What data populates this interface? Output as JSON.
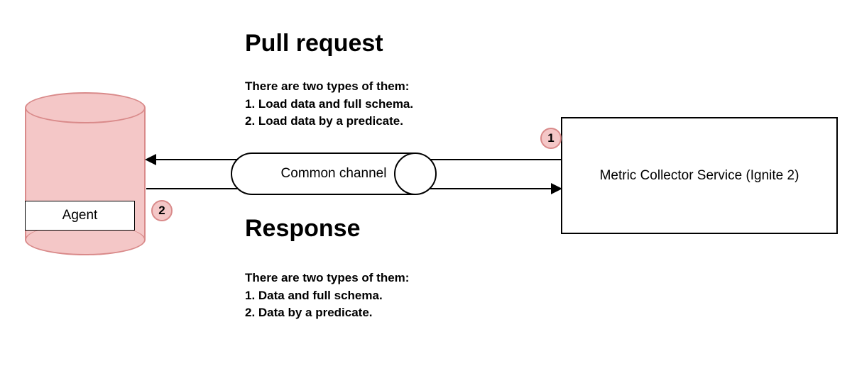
{
  "agent": {
    "label": "Agent"
  },
  "channel": {
    "label": "Common channel"
  },
  "service": {
    "label": "Metric Collector Service (Ignite 2)"
  },
  "badges": {
    "one": "1",
    "two": "2"
  },
  "pull": {
    "title": "Pull request",
    "desc_intro": "There are two types of them:",
    "desc_1": " 1. Load data and full schema.",
    "desc_2": " 2. Load data by a predicate."
  },
  "response": {
    "title": "Response",
    "desc_intro": "There are two types of them:",
    "desc_1": " 1. Data and full schema.",
    "desc_2": " 2. Data by a predicate."
  }
}
